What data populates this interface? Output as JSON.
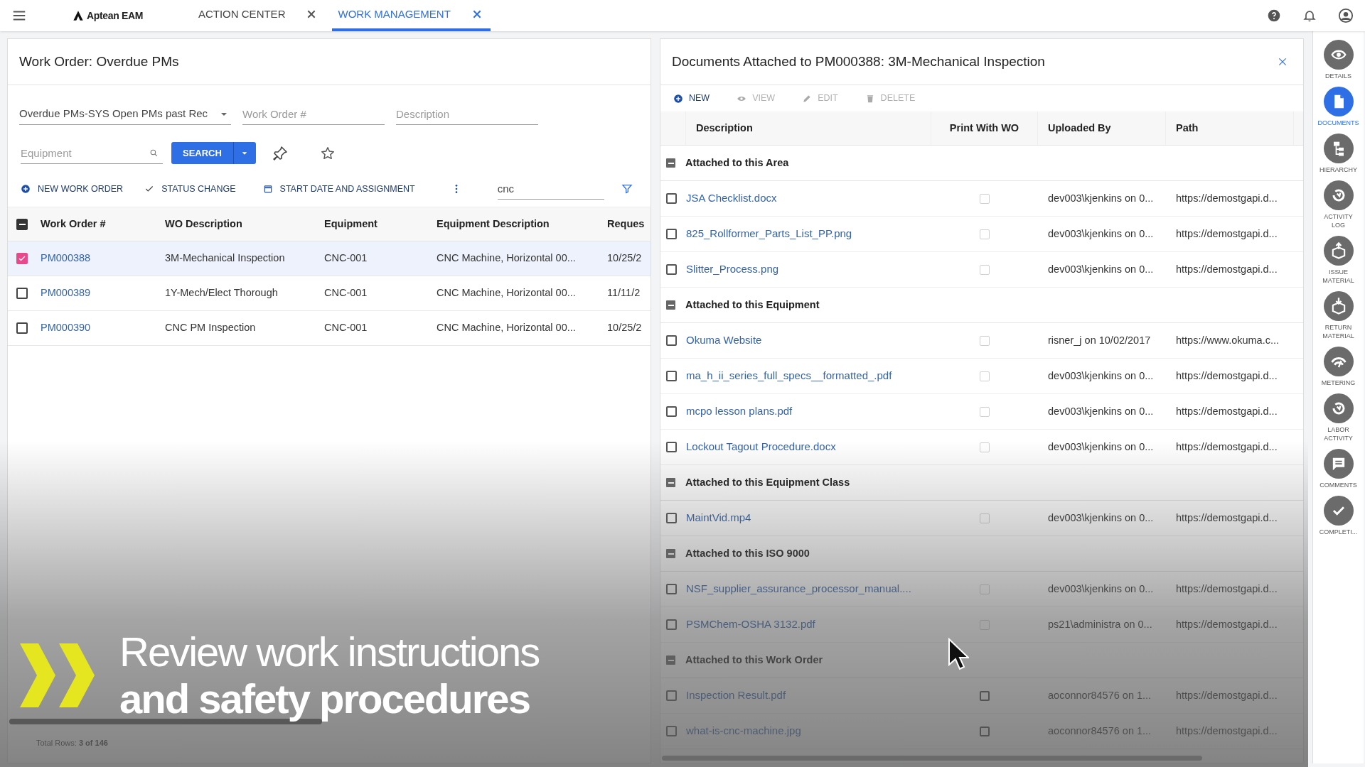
{
  "app_bar": {
    "logo": "Aptean EAM",
    "tabs": [
      {
        "label": "ACTION CENTER",
        "selected": false
      },
      {
        "label": "WORK MANAGEMENT",
        "selected": true
      }
    ]
  },
  "work_order_panel": {
    "title": "Work Order: Overdue PMs",
    "view": "Overdue PMs-SYS Open PMs past Rec",
    "work_order_placeholder": "Work Order #",
    "description_placeholder": "Description",
    "equipment_placeholder": "Equipment",
    "search_button": "SEARCH",
    "actions": [
      {
        "kind": "new",
        "label": "NEW WORK ORDER"
      },
      {
        "kind": "status",
        "label": "STATUS CHANGE"
      },
      {
        "kind": "schedule",
        "label": "START DATE AND ASSIGNMENT"
      }
    ],
    "quick_filter": "cnc",
    "select_all_indeterminate": true,
    "columns": [
      "Work Order #",
      "WO Description",
      "Equipment",
      "Equipment Description",
      "Reques"
    ],
    "rows": [
      {
        "selected": true,
        "cells": [
          "PM000388",
          "3M-Mechanical Inspection",
          "CNC-001",
          "CNC Machine, Horizontal 00...",
          "10/25/2"
        ]
      },
      {
        "selected": false,
        "cells": [
          "PM000389",
          "1Y-Mech/Elect Thorough",
          "CNC-001",
          "CNC Machine, Horizontal 00...",
          "11/11/2"
        ]
      },
      {
        "selected": false,
        "cells": [
          "PM000390",
          "CNC PM Inspection",
          "CNC-001",
          "CNC Machine, Horizontal 00...",
          "10/25/2"
        ]
      }
    ],
    "total_rows": "Total Rows: **3 of 146**"
  },
  "documents_panel": {
    "title": "Documents Attached to PM000388: 3M-Mechanical Inspection",
    "actions": [
      {
        "kind": "new",
        "label": "NEW",
        "disabled": false
      },
      {
        "kind": "view",
        "label": "VIEW",
        "disabled": true
      },
      {
        "kind": "edit",
        "label": "EDIT",
        "disabled": true
      },
      {
        "kind": "delete",
        "label": "DELETE",
        "disabled": true
      }
    ],
    "columns": [
      "Description",
      "Print With WO",
      "Uploaded By",
      "Path"
    ],
    "groups": [
      {
        "label": "Attached to this Area",
        "expanded": true,
        "rows": [
          {
            "description": "JSA Checklist.docx",
            "checked": false,
            "print_disabled": true,
            "uploaded_by": "dev003\\kjenkins on 0...",
            "path": "https://demostgapi.d..."
          },
          {
            "description": "825_Rollformer_Parts_List_PP.png",
            "checked": false,
            "print_disabled": true,
            "uploaded_by": "dev003\\kjenkins on 0...",
            "path": "https://demostgapi.d..."
          },
          {
            "description": "Slitter_Process.png",
            "checked": false,
            "print_disabled": true,
            "uploaded_by": "dev003\\kjenkins on 0...",
            "path": "https://demostgapi.d..."
          }
        ]
      },
      {
        "label": "Attached to this Equipment",
        "expanded": true,
        "rows": [
          {
            "description": "Okuma Website",
            "checked": false,
            "print_disabled": true,
            "uploaded_by": "risner_j on 10/02/2017",
            "path": "https://www.okuma.c..."
          },
          {
            "description": "ma_h_ii_series_full_specs__formatted_.pdf",
            "checked": false,
            "print_disabled": true,
            "uploaded_by": "dev003\\kjenkins on 0...",
            "path": "https://demostgapi.d..."
          },
          {
            "description": "mcpo lesson plans.pdf",
            "checked": false,
            "print_disabled": true,
            "uploaded_by": "dev003\\kjenkins on 0...",
            "path": "https://demostgapi.d..."
          },
          {
            "description": "Lockout Tagout Procedure.docx",
            "checked": false,
            "print_disabled": true,
            "uploaded_by": "dev003\\kjenkins on 0...",
            "path": "https://demostgapi.d..."
          }
        ]
      },
      {
        "label": "Attached to this Equipment Class",
        "expanded": true,
        "rows": [
          {
            "description": "MaintVid.mp4",
            "checked": false,
            "print_disabled": true,
            "uploaded_by": "dev003\\kjenkins on 0...",
            "path": "https://demostgapi.d..."
          }
        ]
      },
      {
        "label": "Attached to this ISO 9000",
        "expanded": true,
        "rows": [
          {
            "description": "NSF_supplier_assurance_processor_manual....",
            "checked": false,
            "print_disabled": true,
            "uploaded_by": "dev003\\kjenkins on 0...",
            "path": "https://demostgapi.d..."
          },
          {
            "description": "PSMChem-OSHA 3132.pdf",
            "checked": false,
            "print_disabled": true,
            "uploaded_by": "ps21\\administra on 0...",
            "path": "https://demostgapi.d..."
          }
        ]
      },
      {
        "label": "Attached to this Work Order",
        "expanded": true,
        "rows": [
          {
            "description": "Inspection Result.pdf",
            "checked": false,
            "print_disabled": false,
            "uploaded_by": "aoconnor84576 on 1...",
            "path": "https://demostgapi.d..."
          },
          {
            "description": "what-is-cnc-machine.jpg",
            "checked": false,
            "print_disabled": false,
            "uploaded_by": "aoconnor84576 on 1...",
            "path": "https://demostgapi.d..."
          }
        ]
      }
    ]
  },
  "side_nav": [
    {
      "kind": "details",
      "label": "DETAILS",
      "selected": false
    },
    {
      "kind": "documents",
      "label": "DOCUMENTS",
      "selected": true
    },
    {
      "kind": "hierarchy",
      "label": "HIERARCHY",
      "selected": false
    },
    {
      "kind": "activity",
      "label": "ACTIVITY LOG",
      "selected": false
    },
    {
      "kind": "issue",
      "label": "ISSUE MATERIAL",
      "selected": false
    },
    {
      "kind": "return",
      "label": "RETURN MATERIAL",
      "selected": false
    },
    {
      "kind": "metering",
      "label": "METERING",
      "selected": false
    },
    {
      "kind": "activity",
      "label": "LABOR ACTIVITY",
      "selected": false
    },
    {
      "kind": "comments",
      "label": "COMMENTS",
      "selected": false
    },
    {
      "kind": "complete",
      "label": "COMPLETI...",
      "selected": false
    }
  ],
  "caption": {
    "line1": "Review work instructions",
    "line2": "and safety procedures"
  }
}
